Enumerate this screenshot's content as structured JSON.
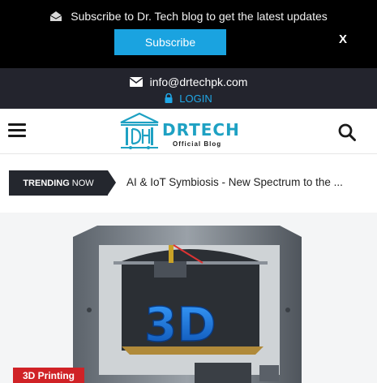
{
  "subscribe_bar": {
    "message": "Subscribe to Dr. Tech blog to get the latest updates",
    "button_label": "Subscribe",
    "close_label": "X"
  },
  "contact": {
    "email": "info@drtechpk.com",
    "login_label": "LOGIN"
  },
  "header": {
    "logo_name": "DRTECH",
    "logo_tagline": "Official Blog"
  },
  "trending": {
    "tag_bold": "TRENDING",
    "tag_light": "NOW",
    "headline": "AI & IoT Symbiosis - New Spectrum to the ..."
  },
  "hero": {
    "printer_label": "3D",
    "category": "3D Printing"
  },
  "colors": {
    "accent_blue": "#1aa3e0",
    "dark_bar": "#23242d",
    "badge_red": "#d02226"
  }
}
